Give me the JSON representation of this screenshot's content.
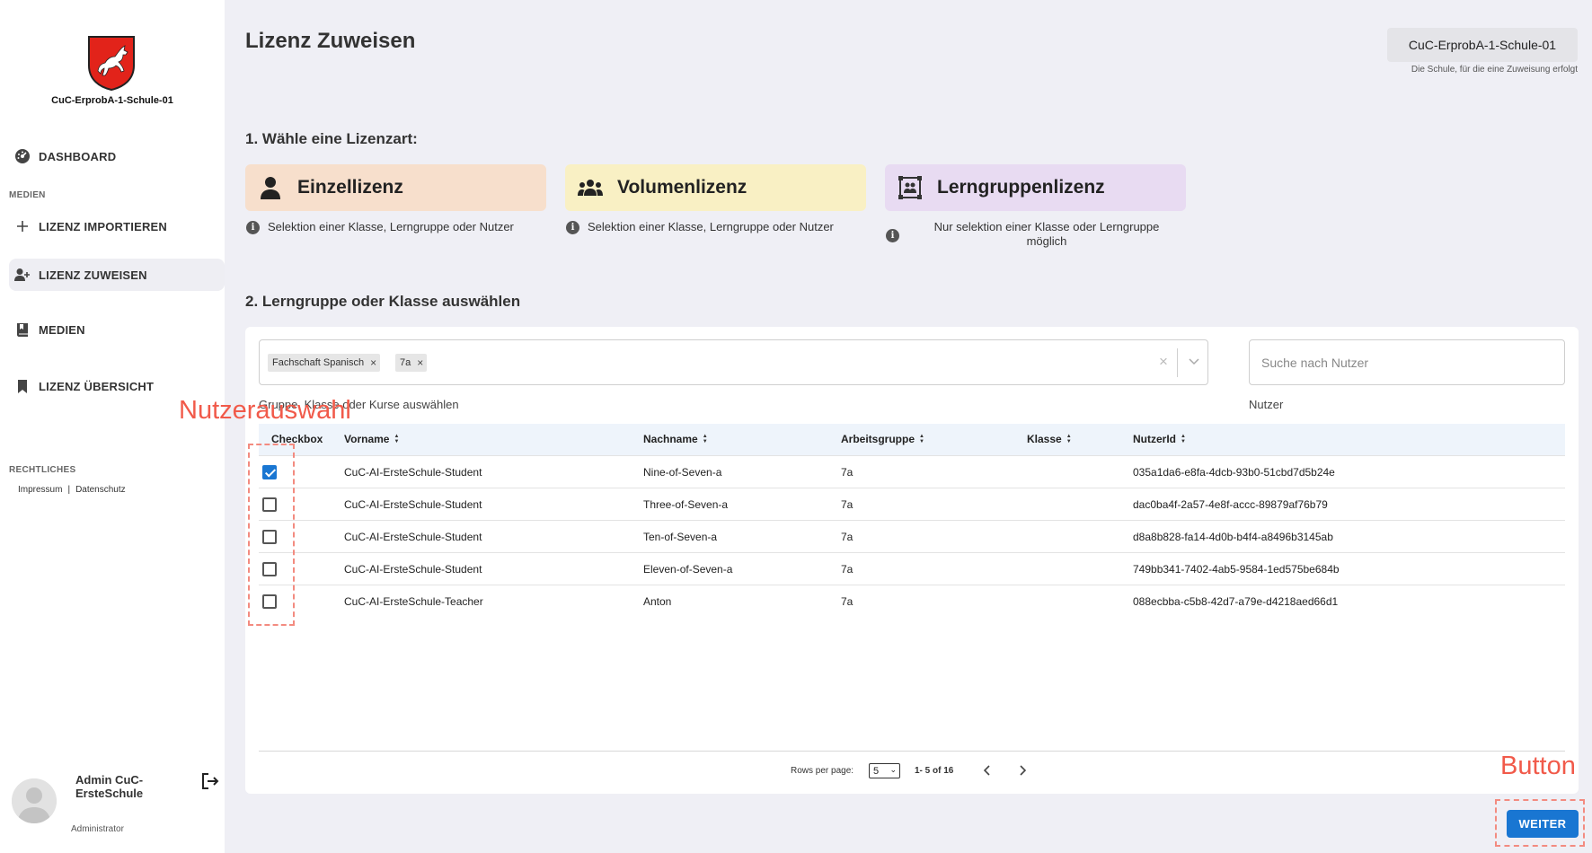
{
  "sidebar": {
    "school_name": "CuC-ErprobA-1-Schule-01",
    "nav": {
      "dashboard": "DASHBOARD",
      "section_medien": "MEDIEN",
      "lizenz_importieren": "LIZENZ IMPORTIEREN",
      "lizenz_zuweisen": "LIZENZ ZUWEISEN",
      "medien": "MEDIEN",
      "lizenz_uebersicht": "LIZENZ ÜBERSICHT",
      "section_rechtliches": "RECHTLICHES",
      "impressum": "Impressum",
      "separator": "|",
      "datenschutz": "Datenschutz"
    },
    "user": {
      "name": "Admin CuC-ErsteSchule",
      "role": "Administrator"
    }
  },
  "header": {
    "title": "Lizenz Zuweisen",
    "school_selector": "CuC-ErprobA-1-Schule-01",
    "school_hint": "Die Schule, für die eine Zuweisung erfolgt"
  },
  "step1": {
    "title": "1. Wähle eine Lizenzart:",
    "cards": [
      {
        "label": "Einzellizenz",
        "description": "Selektion einer Klasse, Lerngruppe oder Nutzer",
        "color": "#f7dfcc",
        "icon": "person-icon"
      },
      {
        "label": "Volumenlizenz",
        "description": "Selektion einer Klasse, Lerngruppe oder Nutzer",
        "color": "#f9f0c4",
        "icon": "group-icon"
      },
      {
        "label": "Lerngruppenlizenz",
        "description_line1": "Nur selektion einer Klasse oder Lerngruppe",
        "description_line2": "möglich",
        "color": "#e8dbf2",
        "icon": "learning-group-icon"
      }
    ]
  },
  "step2": {
    "title": "2. Lerngruppe oder Klasse auswählen",
    "group_select": {
      "chips": [
        "Fachschaft Spanisch",
        "7a"
      ],
      "label": "Gruppe, Klasse oder Kurse auswählen"
    },
    "user_search": {
      "placeholder": "Suche nach Nutzer",
      "label": "Nutzer"
    }
  },
  "table": {
    "columns": [
      "Checkbox",
      "Vorname",
      "Nachname",
      "Arbeitsgruppe",
      "Klasse",
      "NutzerId"
    ],
    "rows": [
      {
        "checked": true,
        "vorname": "CuC-AI-ErsteSchule-Student",
        "nachname": "Nine-of-Seven-a",
        "arbeitsgruppe": "7a",
        "klasse": "",
        "nutzerid": "035a1da6-e8fa-4dcb-93b0-51cbd7d5b24e"
      },
      {
        "checked": false,
        "vorname": "CuC-AI-ErsteSchule-Student",
        "nachname": "Three-of-Seven-a",
        "arbeitsgruppe": "7a",
        "klasse": "",
        "nutzerid": "dac0ba4f-2a57-4e8f-accc-89879af76b79"
      },
      {
        "checked": false,
        "vorname": "CuC-AI-ErsteSchule-Student",
        "nachname": "Ten-of-Seven-a",
        "arbeitsgruppe": "7a",
        "klasse": "",
        "nutzerid": "d8a8b828-fa14-4d0b-b4f4-a8496b3145ab"
      },
      {
        "checked": false,
        "vorname": "CuC-AI-ErsteSchule-Student",
        "nachname": "Eleven-of-Seven-a",
        "arbeitsgruppe": "7a",
        "klasse": "",
        "nutzerid": "749bb341-7402-4ab5-9584-1ed575be684b"
      },
      {
        "checked": false,
        "vorname": "CuC-AI-ErsteSchule-Teacher",
        "nachname": "Anton",
        "arbeitsgruppe": "7a",
        "klasse": "",
        "nutzerid": "088ecbba-c5b8-42d7-a79e-d4218aed66d1"
      }
    ],
    "pagination": {
      "rows_per_page_label": "Rows per page:",
      "rows_per_page": "5",
      "range": "1- 5 of 16"
    }
  },
  "actions": {
    "weiter": "WEITER"
  },
  "annotations": {
    "user_selection": "Nutzerauswahl",
    "button": "Button",
    "color": "#f15a4a"
  },
  "colors": {
    "primary": "#1976d2",
    "background": "#efeff5",
    "table_header": "#eef4fb"
  }
}
